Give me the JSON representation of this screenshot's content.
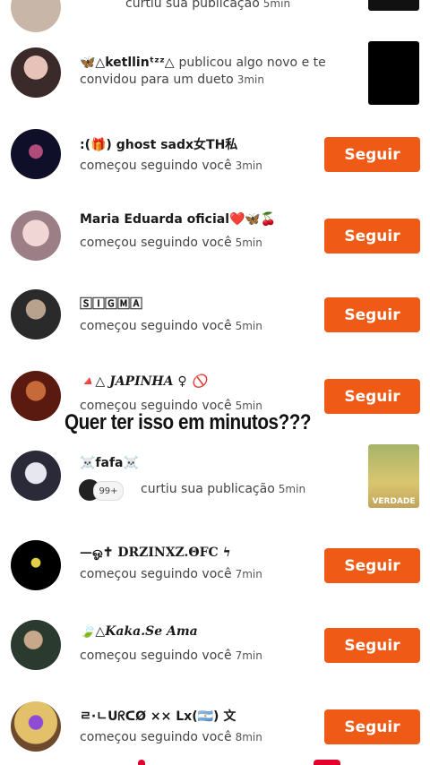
{
  "notifications": [
    {
      "name": "",
      "action": "curtiu sua publicação",
      "time": "5min",
      "button": null
    },
    {
      "name": "🦋△ketllinᵗᶻᶻ△",
      "action_inline": "publicou algo novo e te",
      "action": "convidou para um dueto",
      "time": "3min",
      "button": null
    },
    {
      "name": ":(🎁) ghost sadx女TH私",
      "action": "começou seguindo você",
      "time": "3min",
      "button": "Seguir"
    },
    {
      "name": "Maria Eduarda oficial❤️🦋🍒",
      "action": "começou seguindo você",
      "time": "5min",
      "button": "Seguir"
    },
    {
      "name": "🅂🄸🄶🄼🄰",
      "action": "começou seguindo você",
      "time": "5min",
      "button": "Seguir"
    },
    {
      "name": "🔺△ JAPINHA ♀ 🚫",
      "action": "começou seguindo você",
      "time": "5min",
      "button": "Seguir"
    },
    {
      "name": "☠️fafa☠️",
      "action": "curtiu sua publicação",
      "time": "5min",
      "button": null,
      "badge": "99+",
      "thumb_text": "VERDADE"
    },
    {
      "name": "—ஓ✝ DRZINXZ.ΘFC ϟ",
      "action": "começou seguindo você",
      "time": "7min",
      "button": "Seguir"
    },
    {
      "name": "🍃△Kaka.Se Ama",
      "action": "começou seguindo você",
      "time": "7min",
      "button": "Seguir"
    },
    {
      "name": "ㄹ·ㄴᑌᖇᑕØ ×× Lx(🇦🇷) 文",
      "action": "começou seguindo você",
      "time": "8min",
      "button": "Seguir"
    }
  ],
  "overlay_text": "Quer ter isso em minutos???",
  "colors": {
    "accent": "#f05a17",
    "text": "#1a1a1a",
    "muted": "#444444"
  }
}
